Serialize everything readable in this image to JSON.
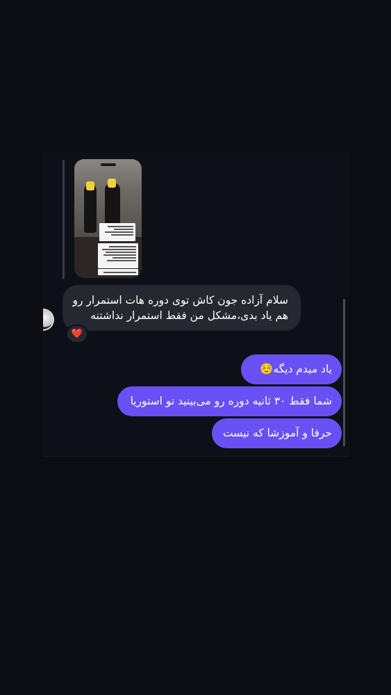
{
  "conversation": {
    "story_reply": {
      "thumbnail_label": "story-thumbnail"
    },
    "incoming": {
      "line1": "سلام آزاده جون کاش توی دوره هات استمرار رو",
      "line2": "هم یاد بدی،مشکل من فقط استمرار نداشتنه",
      "reaction": "❤️"
    },
    "outgoing": [
      {
        "text": "یاد میدم دیگه",
        "emoji": "☺️"
      },
      {
        "text": "شما فقط ۳۰ ثانیه دوره رو می‌بینید تو استوریا"
      },
      {
        "text": "حرفا و آموزشا که نیست"
      }
    ]
  },
  "colors": {
    "background": "#0b0d13",
    "incoming_bubble": "#262830",
    "outgoing_bubble": "#6950f5"
  }
}
